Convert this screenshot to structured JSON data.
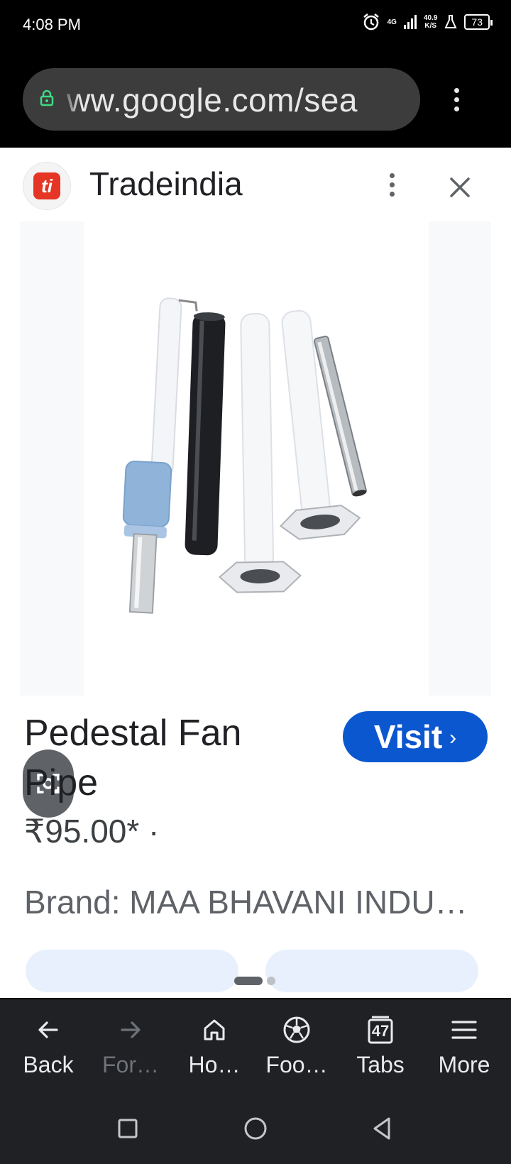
{
  "status": {
    "time": "4:08 PM",
    "network": "4G",
    "speed_top": "40.9",
    "speed_bottom": "K/S",
    "battery": "73"
  },
  "browser": {
    "url": "ww.google.com/sea"
  },
  "card": {
    "site_name": "Tradeindia",
    "site_logo_text": "ti",
    "product_title": "Pedestal Fan Pipe",
    "visit_label": "Visit",
    "price": "₹95.00* ·",
    "brand": "Brand: MAA BHAVANI INDUSTRIES"
  },
  "toolbar": {
    "items": [
      {
        "label": "Back",
        "icon": "arrow-left-icon"
      },
      {
        "label": "For…",
        "icon": "arrow-right-icon"
      },
      {
        "label": "Ho…",
        "icon": "home-icon"
      },
      {
        "label": "Foo…",
        "icon": "football-icon"
      },
      {
        "label": "Tabs",
        "icon": "tabs-icon",
        "count": "47"
      },
      {
        "label": "More",
        "icon": "menu-icon"
      }
    ]
  },
  "colors": {
    "visit_button": "#0b57d0",
    "toolbar_bg": "#202124",
    "logo_red": "#e53524"
  }
}
